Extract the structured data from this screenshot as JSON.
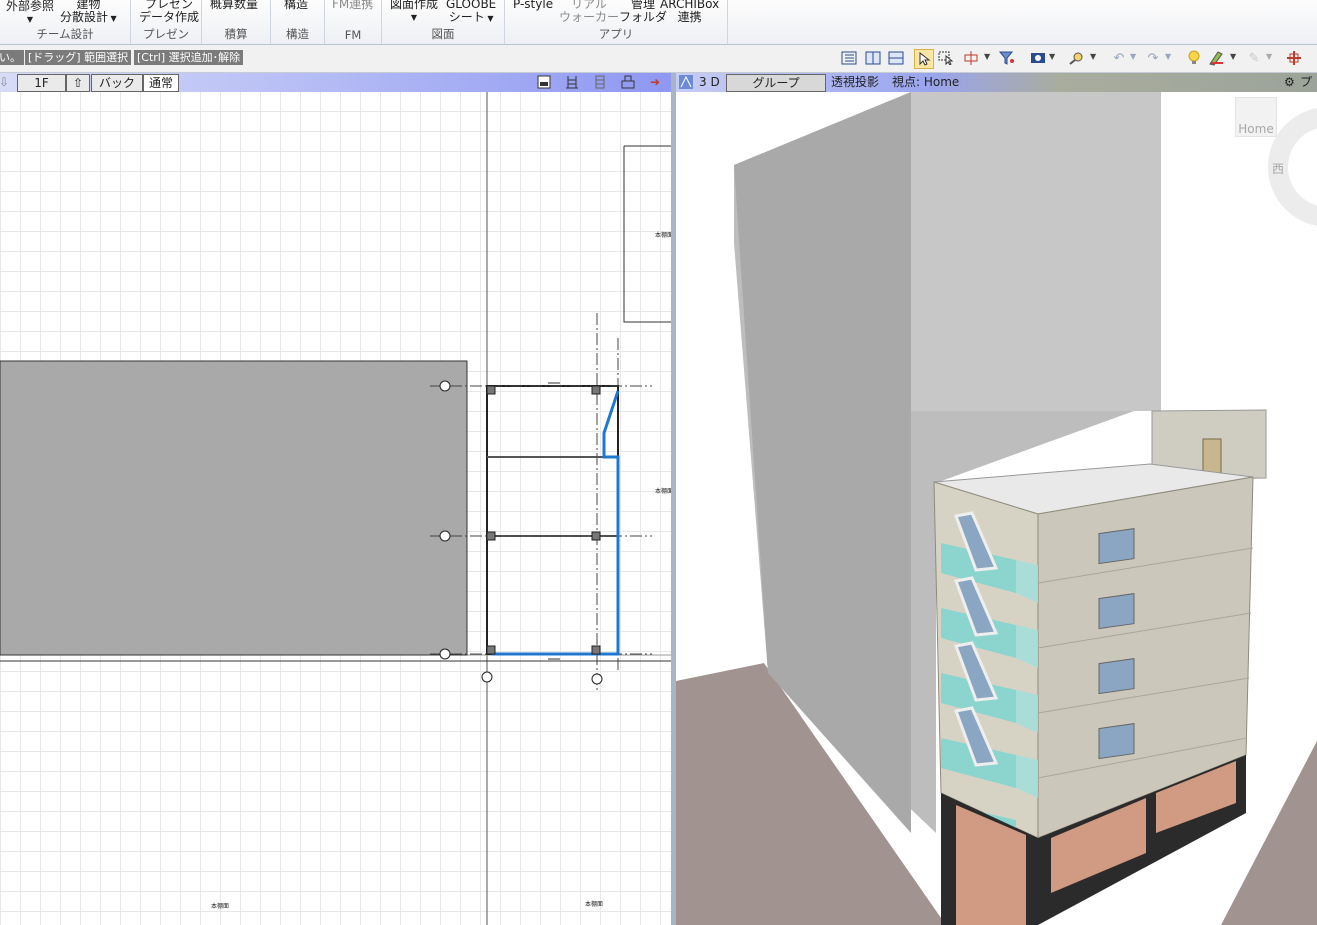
{
  "ribbon": {
    "groups": [
      {
        "label": "チーム設計",
        "buttons": [
          {
            "label": "外部参照",
            "arrow": true
          },
          {
            "label": "建物",
            "label2": "分散設計",
            "arrow": true
          }
        ]
      },
      {
        "label": "プレゼン",
        "buttons": [
          {
            "label": "プレゼン",
            "label2": "データ作成"
          }
        ]
      },
      {
        "label": "積算",
        "buttons": [
          {
            "label": "概算数量"
          }
        ]
      },
      {
        "label": "構造",
        "buttons": [
          {
            "label": "構造"
          }
        ]
      },
      {
        "label": "FM",
        "buttons": [
          {
            "label": "FM連携"
          }
        ]
      },
      {
        "label": "図面",
        "buttons": [
          {
            "label": "図面作成",
            "arrow": true
          },
          {
            "label": "GLOOBE",
            "label2": "シート",
            "arrow": true
          }
        ]
      },
      {
        "label": "アプリ",
        "buttons": [
          {
            "label": "P-style"
          },
          {
            "label": "リアル",
            "label2": "ウォーカー"
          },
          {
            "label": "管理",
            "label2": "フォルダ"
          },
          {
            "label": "ARCHIBox",
            "label2": "連携"
          }
        ]
      }
    ]
  },
  "toolbar": {
    "hints": [
      "い。",
      "[ドラッグ] 範囲選択",
      "[Ctrl] 選択追加･解除"
    ],
    "icons": [
      "list-view-icon",
      "two-pane-icon",
      "horizontal-split-icon",
      "select-pointer-icon",
      "window-select-icon",
      "snap-icon",
      "filter-icon",
      "info-icon",
      "search-icon",
      "undo-icon",
      "redo-icon",
      "bulb-icon",
      "paint-icon",
      "eraser-icon",
      "move-icon"
    ]
  },
  "plan": {
    "floor": "1F",
    "back_label": "バック",
    "mode_label": "通常",
    "small_labels": [
      "本棚面",
      "本棚面",
      "本棚面",
      "本棚面"
    ]
  },
  "view3d": {
    "label": "3 D",
    "group_label": "グループ",
    "projection": "透視投影",
    "viewpoint": "視点: Home",
    "right_label": "プ",
    "home_button": "Home",
    "compass_west": "西"
  },
  "colors": {
    "plan_header": "#8f98f2",
    "selection_blue": "#1f77d0",
    "building_wall": "#cfcbbd",
    "glass": "#7fd3cf",
    "ground": "#b09b95"
  }
}
